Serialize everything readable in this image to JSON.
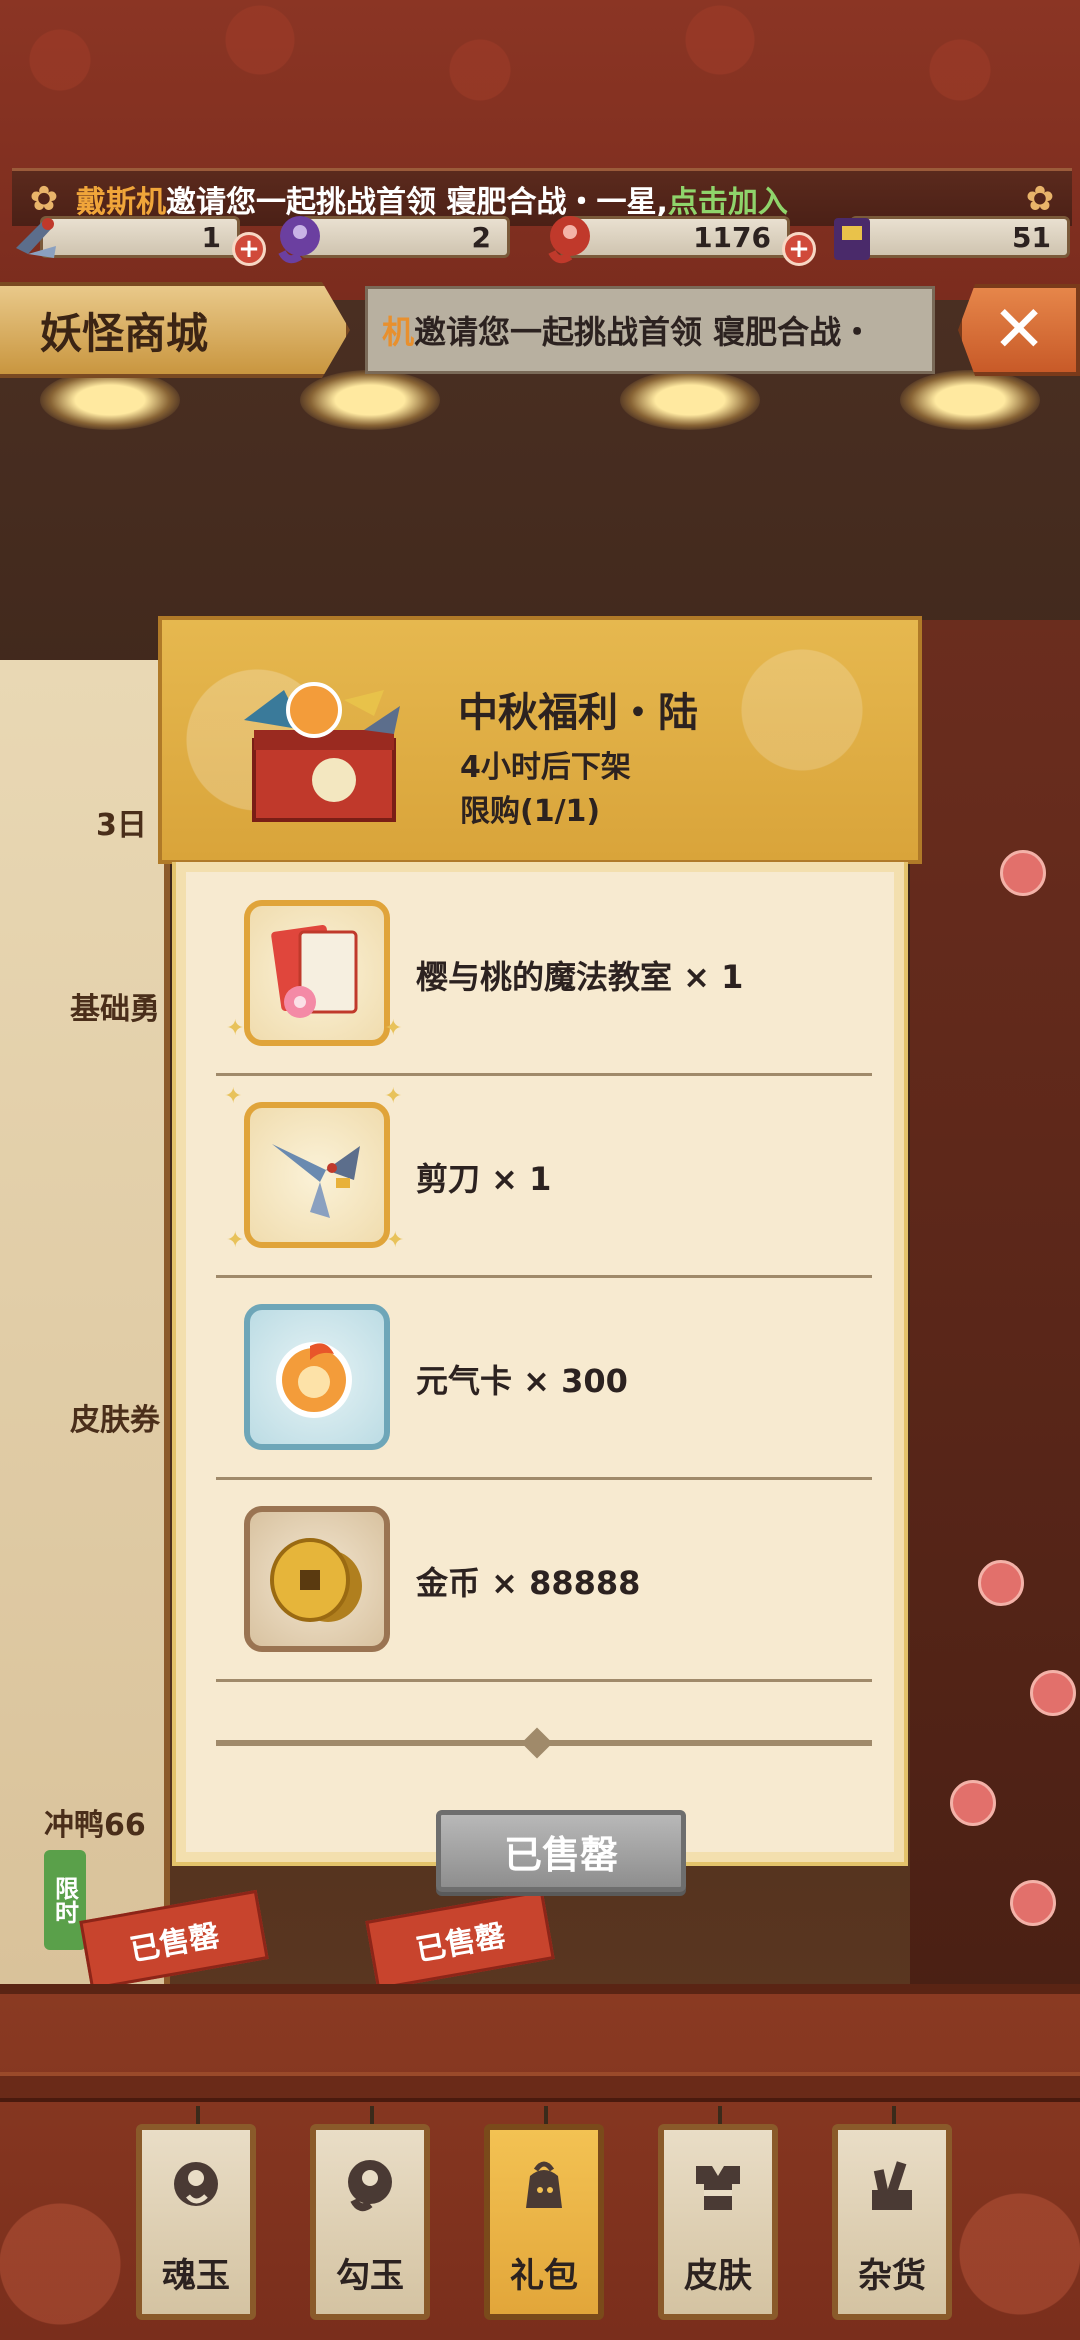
{
  "notice": {
    "inviter": "戴斯机",
    "message": "邀请您一起挑战首领 寝肥合战・一星,",
    "join": "点击加入"
  },
  "currencies": [
    {
      "icon": "scissors-icon",
      "value": "1"
    },
    {
      "icon": "magatama-purple-icon",
      "value": "2"
    },
    {
      "icon": "magatama-red-icon",
      "value": "1176"
    },
    {
      "icon": "ticket-icon",
      "value": "51"
    }
  ],
  "header": {
    "title": "妖怪商城",
    "ticker_who": "机",
    "ticker_text": "邀请您一起挑战首领 寝肥合战・"
  },
  "modal": {
    "pack_title": "中秋福利・陆",
    "pack_expire": "4小时后下架",
    "pack_limit": "限购(1/1)",
    "items": [
      {
        "icon": "red-envelope-icon",
        "label": "樱与桃的魔法教室 × 1"
      },
      {
        "icon": "scissors-icon",
        "label": "剪刀 × 1"
      },
      {
        "icon": "vitality-card-icon",
        "label": "元气卡 × 300"
      },
      {
        "icon": "gold-coin-icon",
        "label": "金币 × 88888"
      }
    ],
    "sold_button": "已售罄"
  },
  "background": {
    "left_labels": [
      "3日",
      "基础勇",
      "皮肤券",
      "冲鸭66"
    ],
    "limited_badge": "限时",
    "sold_tags": [
      "已售罄",
      "已售罄"
    ]
  },
  "tabs": [
    {
      "icon": "soul-jade-icon",
      "label": "魂玉",
      "active": false
    },
    {
      "icon": "magatama-icon",
      "label": "勾玉",
      "active": false
    },
    {
      "icon": "gift-bag-icon",
      "label": "礼包",
      "active": true
    },
    {
      "icon": "kimono-icon",
      "label": "皮肤",
      "active": false
    },
    {
      "icon": "goods-icon",
      "label": "杂货",
      "active": false
    }
  ]
}
